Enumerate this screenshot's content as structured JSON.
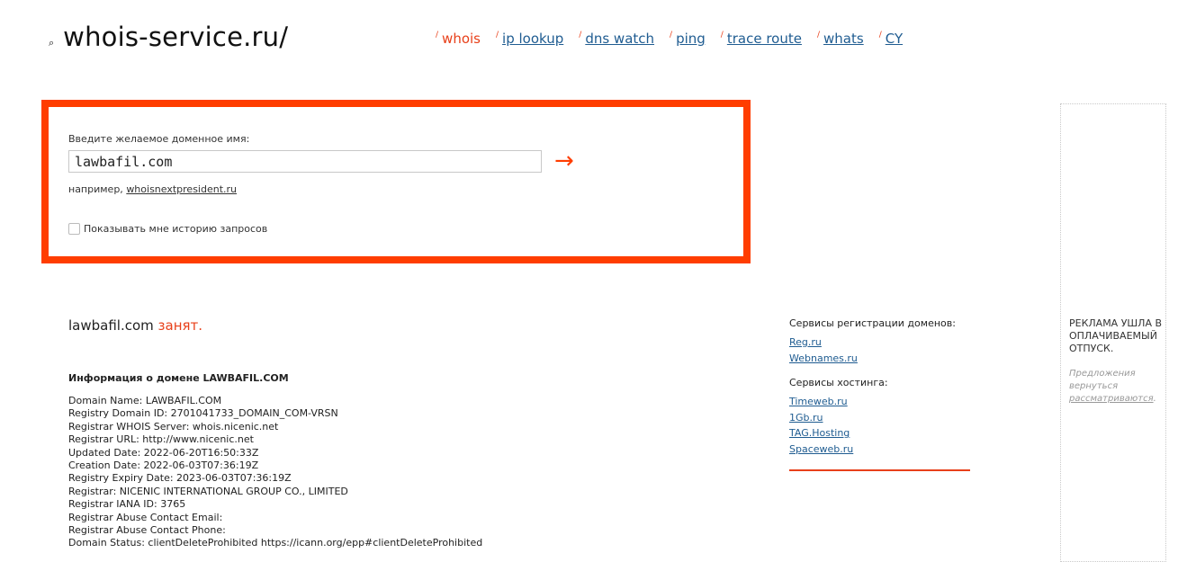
{
  "header": {
    "logo_icon": "⌕",
    "logo_text": "whois-service.ru/",
    "nav": [
      {
        "label": "whois",
        "active": true
      },
      {
        "label": "ip lookup"
      },
      {
        "label": "dns watch"
      },
      {
        "label": "ping"
      },
      {
        "label": "trace route"
      },
      {
        "label": "whats"
      },
      {
        "label": "CY"
      }
    ],
    "nav_separator": "/"
  },
  "search": {
    "label": "Введите желаемое доменное имя:",
    "value": "lawbafil.com",
    "submit_icon": "→",
    "example_prefix": "например, ",
    "example_link": "whoisnextpresident.ru",
    "history_label": "Показывать мне историю запросов",
    "history_checked": false
  },
  "result": {
    "domain": "lawbafil.com",
    "status": "занят."
  },
  "info": {
    "title": "Информация о домене LAWBAFIL.COM",
    "lines": [
      "Domain Name: LAWBAFIL.COM",
      "Registry Domain ID: 2701041733_DOMAIN_COM-VRSN",
      "Registrar WHOIS Server: whois.nicenic.net",
      "Registrar URL: http://www.nicenic.net",
      "Updated Date: 2022-06-20T16:50:33Z",
      "Creation Date: 2022-06-03T07:36:19Z",
      "Registry Expiry Date: 2023-06-03T07:36:19Z",
      "Registrar: NICENIC INTERNATIONAL GROUP CO., LIMITED",
      "Registrar IANA ID: 3765",
      "Registrar Abuse Contact Email:",
      "Registrar Abuse Contact Phone:",
      "Domain Status: clientDeleteProhibited https://icann.org/epp#clientDeleteProhibited"
    ]
  },
  "services": {
    "registration_heading": "Сервисы регистрации доменов:",
    "registration_links": [
      "Reg.ru",
      "Webnames.ru"
    ],
    "hosting_heading": "Сервисы хостинга:",
    "hosting_links": [
      "Timeweb.ru",
      "1Gb.ru",
      "TAG.Hosting",
      "Spaceweb.ru"
    ]
  },
  "ad": {
    "title": "Реклама ушла в оплачиваемый отпуск.",
    "note_prefix": "Предложения вернуться ",
    "note_link": "рассматриваются",
    "note_suffix": "."
  },
  "colors": {
    "accent": "#ff3d00",
    "link": "#1f5c91",
    "nav_active": "#e8401a"
  }
}
